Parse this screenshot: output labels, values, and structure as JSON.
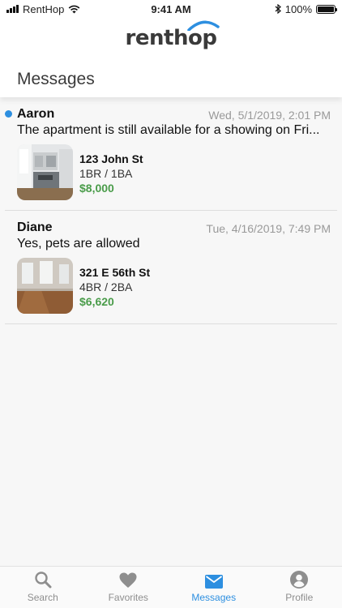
{
  "status_bar": {
    "carrier": "RentHop",
    "time": "9:41 AM",
    "battery": "100%"
  },
  "header": {
    "logo_text": "renthop"
  },
  "page": {
    "title": "Messages"
  },
  "messages": [
    {
      "name": "Aaron",
      "unread": true,
      "date": "Wed, 5/1/2019, 2:01 PM",
      "preview": "The apartment is still available for a showing on Fri...",
      "listing": {
        "address": "123 John St",
        "beds_baths": "1BR / 1BA",
        "price": "$8,000"
      }
    },
    {
      "name": "Diane",
      "unread": false,
      "date": "Tue, 4/16/2019, 7:49 PM",
      "preview": "Yes, pets are allowed",
      "listing": {
        "address": "321 E 56th St",
        "beds_baths": "4BR / 2BA",
        "price": "$6,620"
      }
    }
  ],
  "tabbar": {
    "tabs": [
      {
        "label": "Search",
        "icon": "search-icon",
        "active": false
      },
      {
        "label": "Favorites",
        "icon": "heart-icon",
        "active": false
      },
      {
        "label": "Messages",
        "icon": "envelope-icon",
        "active": true
      },
      {
        "label": "Profile",
        "icon": "user-icon",
        "active": false
      }
    ]
  },
  "colors": {
    "accent": "#2d8fe0",
    "price_green": "#4a9c4a",
    "unread_dot": "#2d8fe0"
  }
}
